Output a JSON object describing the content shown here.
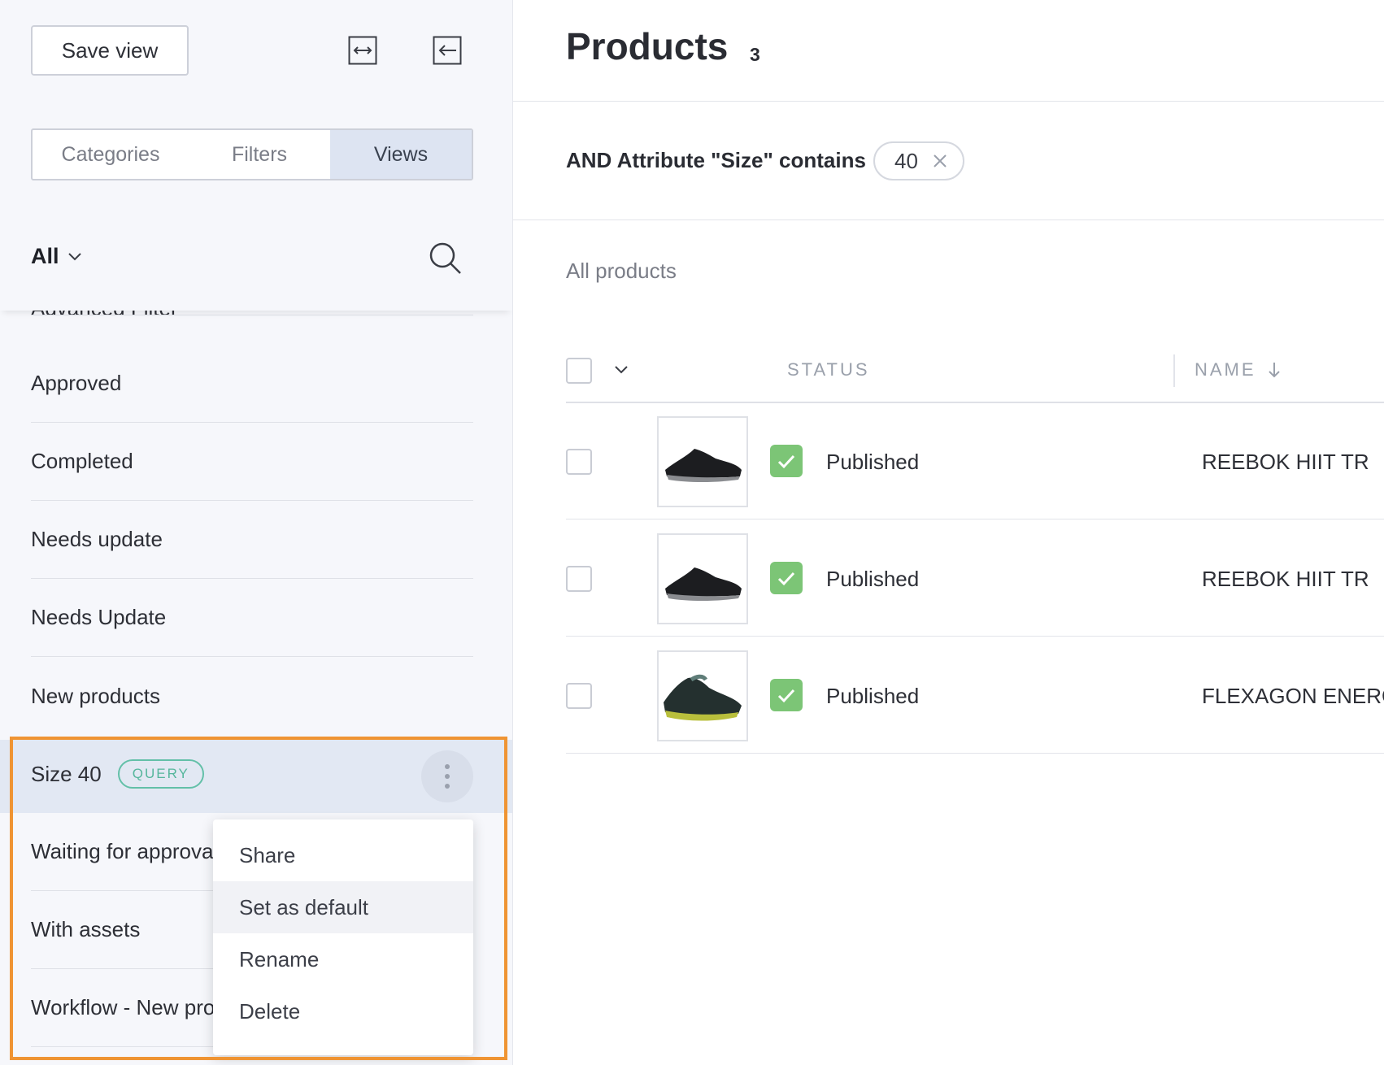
{
  "sidebar": {
    "save_label": "Save view",
    "tabs": [
      {
        "label": "Categories",
        "active": false
      },
      {
        "label": "Filters",
        "active": false
      },
      {
        "label": "Views",
        "active": true
      }
    ],
    "scope": "All",
    "views": [
      {
        "label": "Approved"
      },
      {
        "label": "Completed"
      },
      {
        "label": "Needs update"
      },
      {
        "label": "Needs Update"
      },
      {
        "label": "New products"
      },
      {
        "label": "Size 40",
        "badge": "QUERY",
        "selected": true
      },
      {
        "label": "Waiting for approval"
      },
      {
        "label": "With assets"
      },
      {
        "label": "Workflow - New products"
      }
    ],
    "context_menu": [
      "Share",
      "Set as default",
      "Rename",
      "Delete"
    ]
  },
  "main": {
    "title": "Products",
    "count": "3",
    "filter_text": "AND Attribute \"Size\" contains",
    "filter_value": "40",
    "subtitle": "All products",
    "columns": [
      "STATUS",
      "NAME"
    ],
    "rows": [
      {
        "status": "Published",
        "name": "REEBOK HIIT TR"
      },
      {
        "status": "Published",
        "name": "REEBOK HIIT TR"
      },
      {
        "status": "Published",
        "name": "FLEXAGON ENERGY"
      }
    ]
  },
  "colors": {
    "accent_highlight": "#ef9433",
    "published": "#7cc576",
    "query_badge": "#55b69c"
  }
}
